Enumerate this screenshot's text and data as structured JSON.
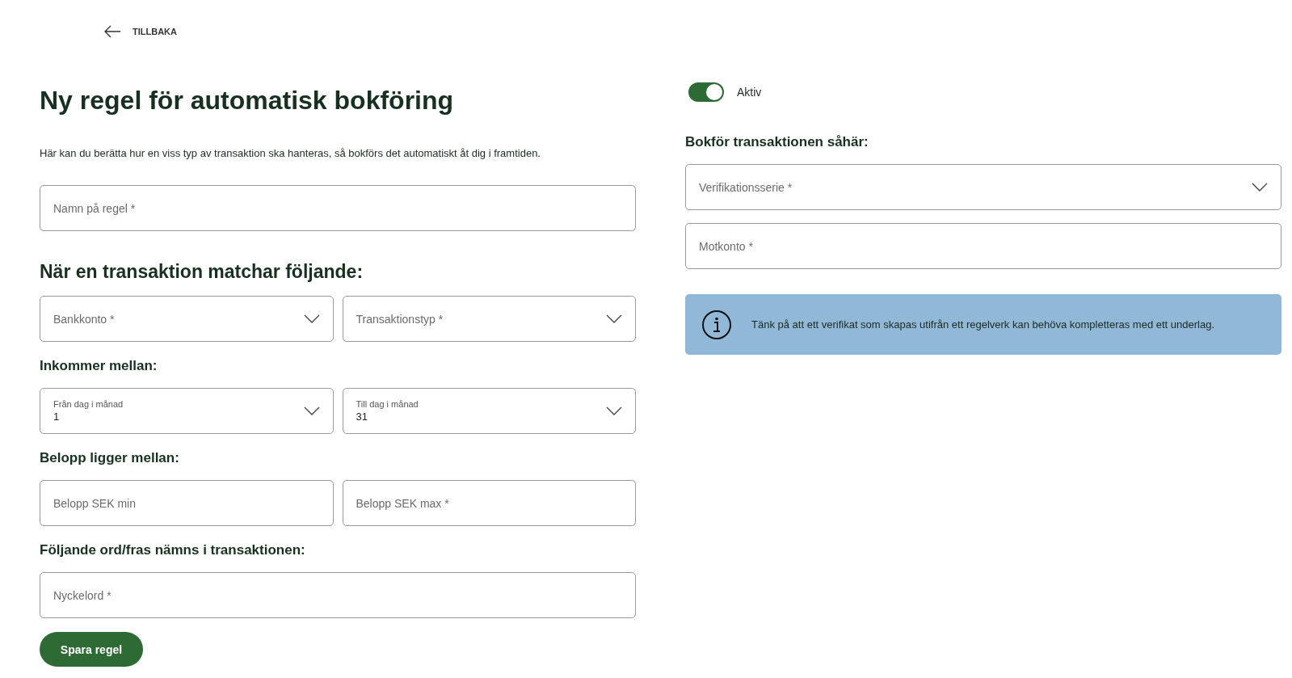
{
  "back_link": {
    "label": "TILLBAKA"
  },
  "title": "Ny regel för automatisk bokföring",
  "description": "Här kan du berätta hur en viss typ av transaktion ska hanteras, så bokförs det automatiskt åt dig i framtiden.",
  "name_field": {
    "kind": "text",
    "placeholder": "Namn på regel *"
  },
  "match_heading": "När en transaktion matchar följande:",
  "match_fields": [
    {
      "kind": "select",
      "placeholder": "Bankkonto *"
    },
    {
      "kind": "select",
      "placeholder": "Transaktionstyp *"
    }
  ],
  "groups": [
    {
      "heading": "Inkommer mellan:",
      "fields": [
        {
          "kind": "select",
          "label": "Från dag i månad",
          "value": "1"
        },
        {
          "kind": "select",
          "label": "Till dag i månad",
          "value": "31"
        }
      ]
    },
    {
      "heading": "Belopp ligger mellan:",
      "fields": [
        {
          "kind": "text",
          "placeholder": "Belopp SEK min"
        },
        {
          "kind": "text",
          "placeholder": "Belopp SEK max *"
        }
      ]
    },
    {
      "heading": "Följande ord/fras nämns i transaktionen:",
      "fields": [
        {
          "kind": "text",
          "placeholder": "Nyckelord *"
        }
      ]
    }
  ],
  "save_button": "Spara regel",
  "active_toggle": {
    "label": "Aktiv",
    "on": true
  },
  "booking_heading": "Bokför transaktionen såhär:",
  "booking_fields": [
    {
      "kind": "select",
      "placeholder": "Verifikationsserie *"
    },
    {
      "kind": "text",
      "placeholder": "Motkonto *"
    }
  ],
  "info": {
    "text": "Tänk på att ett verifikat som skapas utifrån ett regelverk kan behöva kompletteras med ett underlag."
  }
}
